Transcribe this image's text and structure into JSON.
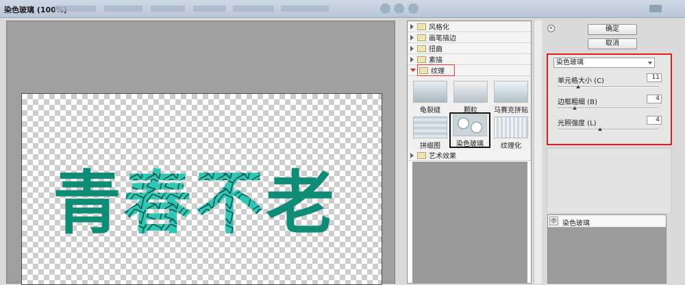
{
  "window": {
    "title": "染色玻璃 (100%)"
  },
  "categories": {
    "stylize": "风格化",
    "brush_strokes": "画笔描边",
    "distort": "扭曲",
    "sketch": "素描",
    "texture": "纹理",
    "artistic": "艺术效果"
  },
  "texture_filters": [
    "龟裂缝",
    "颗粒",
    "马赛克拼贴",
    "拼缀图",
    "染色玻璃",
    "纹理化"
  ],
  "buttons": {
    "ok": "确定",
    "cancel": "取消"
  },
  "collapse_glyph": "«",
  "selected_filter": "染色玻璃",
  "params": {
    "cell_size": {
      "label": "单元格大小 (C)",
      "value": "11",
      "fraction": 0.2
    },
    "border_thickness": {
      "label": "边框粗细 (B)",
      "value": "4",
      "fraction": 0.17
    },
    "light_intensity": {
      "label": "光照强度 (L)",
      "value": "4",
      "fraction": 0.42
    }
  },
  "layers": [
    {
      "name": "染色玻璃",
      "eye": "👁"
    }
  ],
  "canvas_text": "青春不老",
  "colors": {
    "text_teal": "#0f8c76",
    "glass_teal": "#2ec7b5",
    "highlight_red": "#e21a1a"
  }
}
